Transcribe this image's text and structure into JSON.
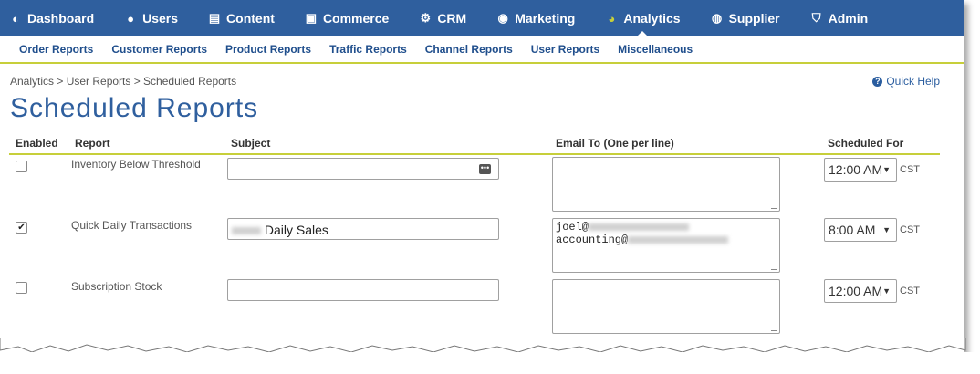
{
  "topnav": {
    "items": [
      {
        "label": "Dashboard",
        "icon": "dashboard-icon",
        "glyph": "◐"
      },
      {
        "label": "Users",
        "icon": "users-icon",
        "glyph": "👥"
      },
      {
        "label": "Content",
        "icon": "document-icon",
        "glyph": "▤"
      },
      {
        "label": "Commerce",
        "icon": "money-icon",
        "glyph": "▣"
      },
      {
        "label": "CRM",
        "icon": "cogs-icon",
        "glyph": "⚙"
      },
      {
        "label": "Marketing",
        "icon": "target-icon",
        "glyph": "◉"
      },
      {
        "label": "Analytics",
        "icon": "pie-chart-icon",
        "glyph": "◕"
      },
      {
        "label": "Supplier",
        "icon": "globe-icon",
        "glyph": "◍"
      },
      {
        "label": "Admin",
        "icon": "shield-icon",
        "glyph": "⛉"
      }
    ],
    "active": "Analytics",
    "active_color": "#c7cf3a",
    "bg_color": "#2f5f9e"
  },
  "subnav": {
    "items": [
      "Order Reports",
      "Customer Reports",
      "Product Reports",
      "Traffic Reports",
      "Channel Reports",
      "User Reports",
      "Miscellaneous"
    ]
  },
  "breadcrumb": "Analytics > User Reports > Scheduled Reports",
  "quick_help": "Quick Help",
  "page_title": "Scheduled Reports",
  "table": {
    "headers": {
      "enabled": "Enabled",
      "report": "Report",
      "subject": "Subject",
      "email": "Email To (One per line)",
      "scheduled": "Scheduled For"
    },
    "rows": [
      {
        "enabled": false,
        "checkmark": "",
        "report": "Inventory Below Threshold",
        "subject_text": "",
        "email_line1": "",
        "email_line2": "",
        "time": "12:00 AM",
        "tz": "CST"
      },
      {
        "enabled": true,
        "checkmark": "✔",
        "report": "Quick Daily Transactions",
        "subject_text": "Daily Sales",
        "email_line1": "joel@",
        "email_line2": "accounting@",
        "time": "8:00 AM",
        "tz": "CST"
      },
      {
        "enabled": false,
        "checkmark": "",
        "report": "Subscription Stock",
        "subject_text": "",
        "email_line1": "",
        "email_line2": "",
        "time": "12:00 AM",
        "tz": "CST"
      }
    ]
  },
  "select_arrow": "▼",
  "dots_glyph": "•••",
  "help_glyph": "?"
}
